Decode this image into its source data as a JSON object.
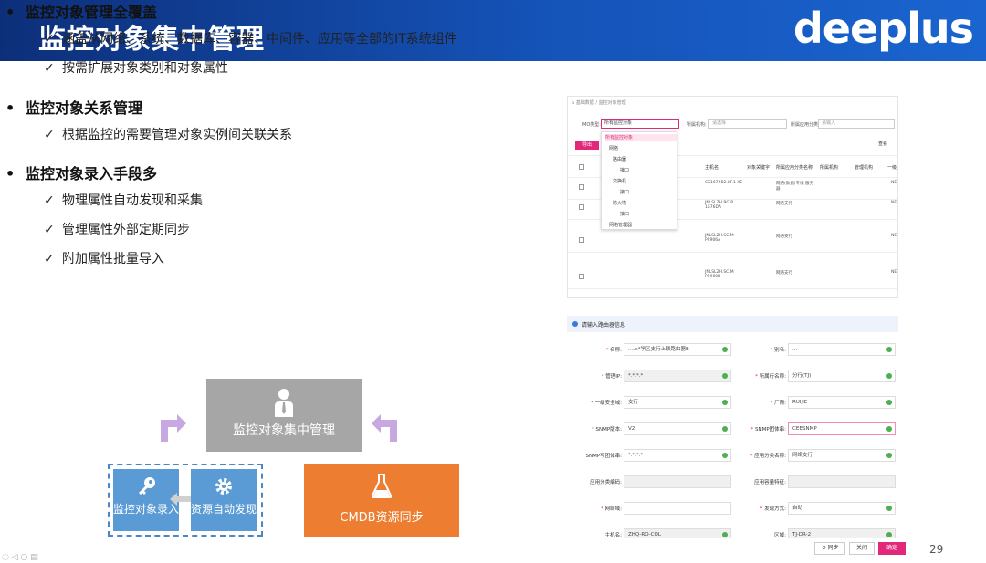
{
  "header": {
    "title": "监控对象集中管理",
    "logo": "deeplus"
  },
  "bullets": [
    {
      "text": "监控对象管理全覆盖",
      "subs": [
        "涵盖从网络、系统、数据库、容器、中间件、应用等全部的IT系统组件",
        "按需扩展对象类别和对象属性"
      ]
    },
    {
      "text": "监控对象关系管理",
      "subs": [
        "根据监控的需要管理对象实例间关联关系"
      ]
    },
    {
      "text": "监控对象录入手段多",
      "subs": [
        "物理属性自动发现和采集",
        "管理属性外部定期同步",
        "附加属性批量导入"
      ]
    }
  ],
  "diagram": {
    "center": "监控对象集中管理",
    "entry": "监控对象录入",
    "discover": "资源自动发现",
    "cmdb": "CMDB资源同步"
  },
  "shot1": {
    "crumb": "⌂ 基础数据 / 监控对象管理",
    "mo_label": "MO类型:",
    "mo_value": "所有监控对象",
    "org_label": "所属机构:",
    "org_placeholder": "请选择",
    "app_label": "所属应用分类:",
    "app_placeholder": "请输入",
    "export_btn": "导出",
    "view_btn": "查看",
    "tree": [
      "所有监控对象",
      "网络",
      "路由器",
      "接口",
      "交换机",
      "接口",
      "防火墙",
      "接口",
      "网络管理器"
    ],
    "headers": [
      "对象名称",
      "主机名",
      "对象关键字",
      "所属应用分类名称",
      "所属机构",
      "管理机构",
      "一级"
    ],
    "rows": [
      [
        "CS1672B2.8F.1 XE",
        "网络(数据)专线 服务器",
        "NETW"
      ],
      [
        "JNLSLZH.BG.R 1576DA",
        "网络支行",
        "NETW"
      ],
      [
        "JNLSLZH.SC.M P2906A",
        "网络支行",
        "NETW"
      ],
      [
        "JNLSLZH.SC.M P2900B",
        "网络支行",
        "NETW"
      ]
    ]
  },
  "shot2": {
    "section": "请输入路由器信息",
    "fields_left": [
      {
        "label": "名称",
        "value": "...上*学区支行上联路由器B",
        "req": true
      },
      {
        "label": "管理IP",
        "value": "*.*.*.*",
        "req": true
      },
      {
        "label": "一级安全域",
        "value": "支行",
        "req": true
      },
      {
        "label": "SNMP版本",
        "value": "V2",
        "req": true
      },
      {
        "label": "SNMP写团体串",
        "value": "*.*.*.*",
        "req": false
      },
      {
        "label": "应用分类编码",
        "value": "",
        "req": false
      },
      {
        "label": "网络域",
        "value": "",
        "req": true
      },
      {
        "label": "主机名",
        "value": "ZHQ-RO-COL",
        "req": false
      }
    ],
    "fields_right": [
      {
        "label": "别名",
        "value": "...",
        "req": true
      },
      {
        "label": "所属行名称",
        "value": "分行(TJ)",
        "req": true
      },
      {
        "label": "厂商",
        "value": "RUIJIE",
        "req": true
      },
      {
        "label": "SNMP团体串",
        "value": "CEBSNMP",
        "req": true
      },
      {
        "label": "应用分类名称",
        "value": "网络支行",
        "req": true
      },
      {
        "label": "应用容量特征",
        "value": "",
        "req": false
      },
      {
        "label": "发现方式",
        "value": "自动",
        "req": true
      },
      {
        "label": "区域",
        "value": "TJ-DR-2",
        "req": false
      }
    ],
    "btn_sync": "⟲ 同步",
    "btn_close": "关闭",
    "btn_ok": "确定"
  },
  "page_number": "29",
  "colors": {
    "header": "#1553b8",
    "gray": "#a6a6a6",
    "blue": "#5b9bd5",
    "orange": "#ed7d31",
    "accent": "#e2287a"
  }
}
